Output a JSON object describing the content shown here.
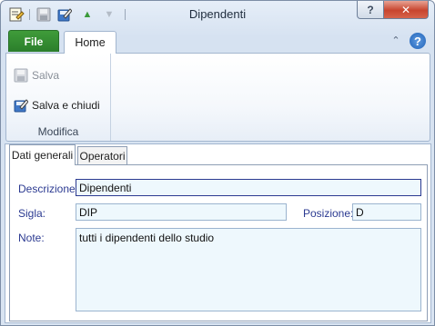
{
  "window": {
    "title": "Dipendenti"
  },
  "quick_access": {
    "icons": [
      "app-icon",
      "save-icon",
      "save-close-icon",
      "move-up-icon",
      "move-down-icon"
    ],
    "up_glyph": "▲",
    "down_glyph": "▼"
  },
  "window_buttons": {
    "help": "?",
    "close": "✕"
  },
  "ribbon": {
    "tabs": {
      "file": "File",
      "home": "Home"
    },
    "minimize_glyph": "⌃",
    "help_glyph": "?",
    "group": {
      "label": "Modifica",
      "buttons": {
        "salva": "Salva",
        "salva_chiudi": "Salva e chiudi"
      }
    }
  },
  "form": {
    "tabs": {
      "general": "Dati generali",
      "operators": "Operatori"
    },
    "fields": {
      "descrizione": {
        "label": "Descrizione:",
        "value": "Dipendenti"
      },
      "sigla": {
        "label": "Sigla:",
        "value": "DIP"
      },
      "posizione": {
        "label": "Posizione:",
        "value": "D"
      },
      "note": {
        "label": "Note:",
        "value": "tutti i dipendenti dello studio"
      }
    }
  },
  "colors": {
    "label": "#2b3a91",
    "field_bg": "#eef8fd",
    "file_tab": "#2b7e2b",
    "close_button": "#c8452e"
  }
}
